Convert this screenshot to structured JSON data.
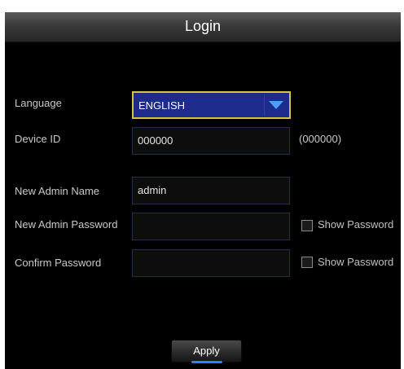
{
  "dialog": {
    "title": "Login",
    "language": {
      "label": "Language",
      "value": "ENGLISH"
    },
    "device_id": {
      "label": "Device ID",
      "value": "000000",
      "hint": "(000000)"
    },
    "admin_name": {
      "label": "New Admin Name",
      "value": "admin"
    },
    "admin_password": {
      "label": "New Admin Password",
      "value": "",
      "show_password_label": "Show Password"
    },
    "confirm_password": {
      "label": "Confirm Password",
      "value": "",
      "show_password_label": "Show Password"
    },
    "apply_label": "Apply"
  },
  "colors": {
    "background": "#000000",
    "select_fill": "#1c2b8c",
    "select_focus_border": "#d6c43a",
    "field_border": "#1d3050",
    "button_glow": "#2f7fff"
  },
  "icons": {
    "dropdown": "triangle-down-icon"
  }
}
